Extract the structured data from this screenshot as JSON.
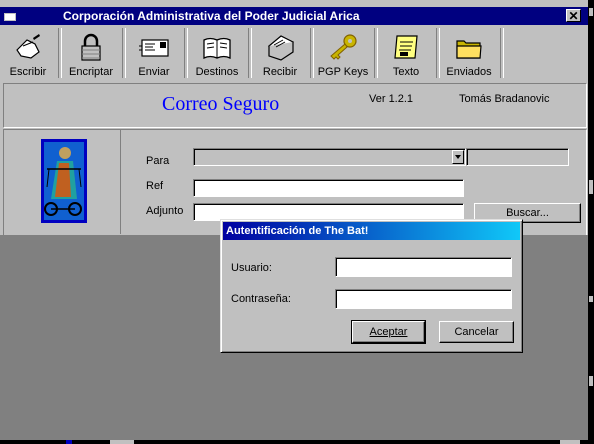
{
  "window": {
    "title": "Corporación Administrativa del Poder Judicial Arica",
    "close_glyph": "✕"
  },
  "toolbar": {
    "items": [
      {
        "label": "Escribir",
        "icon": "write-hand-icon"
      },
      {
        "label": "Encriptar",
        "icon": "padlock-icon"
      },
      {
        "label": "Enviar",
        "icon": "send-envelope-icon"
      },
      {
        "label": "Destinos",
        "icon": "address-book-icon"
      },
      {
        "label": "Recibir",
        "icon": "receive-envelope-icon"
      },
      {
        "label": "PGP Keys",
        "icon": "key-icon"
      },
      {
        "label": "Texto",
        "icon": "text-note-icon"
      },
      {
        "label": "Enviados",
        "icon": "folder-icon"
      }
    ]
  },
  "header": {
    "app_title": "Correo Seguro",
    "version": "Ver 1.2.1",
    "author": "Tomás Bradanovic"
  },
  "form": {
    "para_label": "Para",
    "para_value": "",
    "para_extra_value": "",
    "ref_label": "Ref",
    "ref_value": "",
    "adjunto_label": "Adjunto",
    "adjunto_value": "",
    "buscar_label": "Buscar..."
  },
  "dialog": {
    "title": "Autentificación de The Bat!",
    "usuario_label": "Usuario:",
    "usuario_value": "",
    "contrasena_label": "Contraseña:",
    "contrasena_value": "",
    "aceptar_label": "Aceptar",
    "cancelar_label": "Cancelar"
  },
  "colors": {
    "titlebar": "#000080",
    "app_title": "#0000ff",
    "face": "#c0c0c0",
    "workspace": "#808080",
    "dialog_title_start": "#0000a0",
    "dialog_title_end": "#10c8f8"
  }
}
